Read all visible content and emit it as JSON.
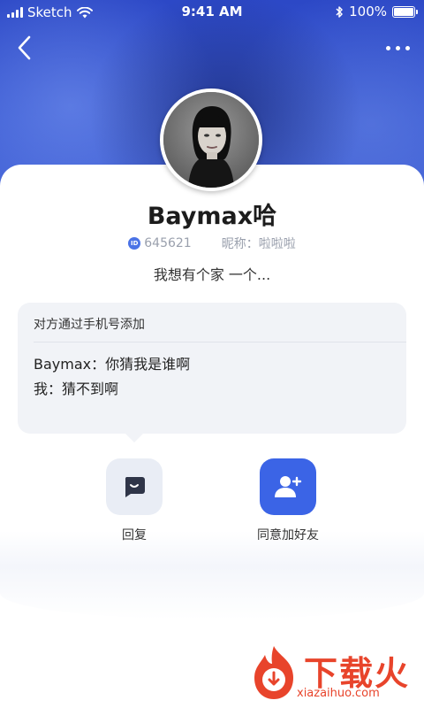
{
  "status_bar": {
    "carrier": "Sketch",
    "time": "9:41 AM",
    "battery": "100%"
  },
  "profile": {
    "name": "Baymax哈",
    "id_icon": "ID",
    "id_value": "645621",
    "nickname": "昵称：啦啦啦",
    "signature": "我想有个家 一个..."
  },
  "request": {
    "source": "对方通过手机号添加",
    "messages": [
      "Baymax：你猜我是谁啊",
      "我：猜不到啊"
    ]
  },
  "actions": {
    "reply_label": "回复",
    "add_label": "同意加好友"
  },
  "watermark": {
    "text": "下载火",
    "url": "xiazaihuo.com"
  },
  "colors": {
    "header_blue": "#3a5ad3",
    "accent_blue": "#3b64e6",
    "watermark_red": "#e8442b"
  }
}
